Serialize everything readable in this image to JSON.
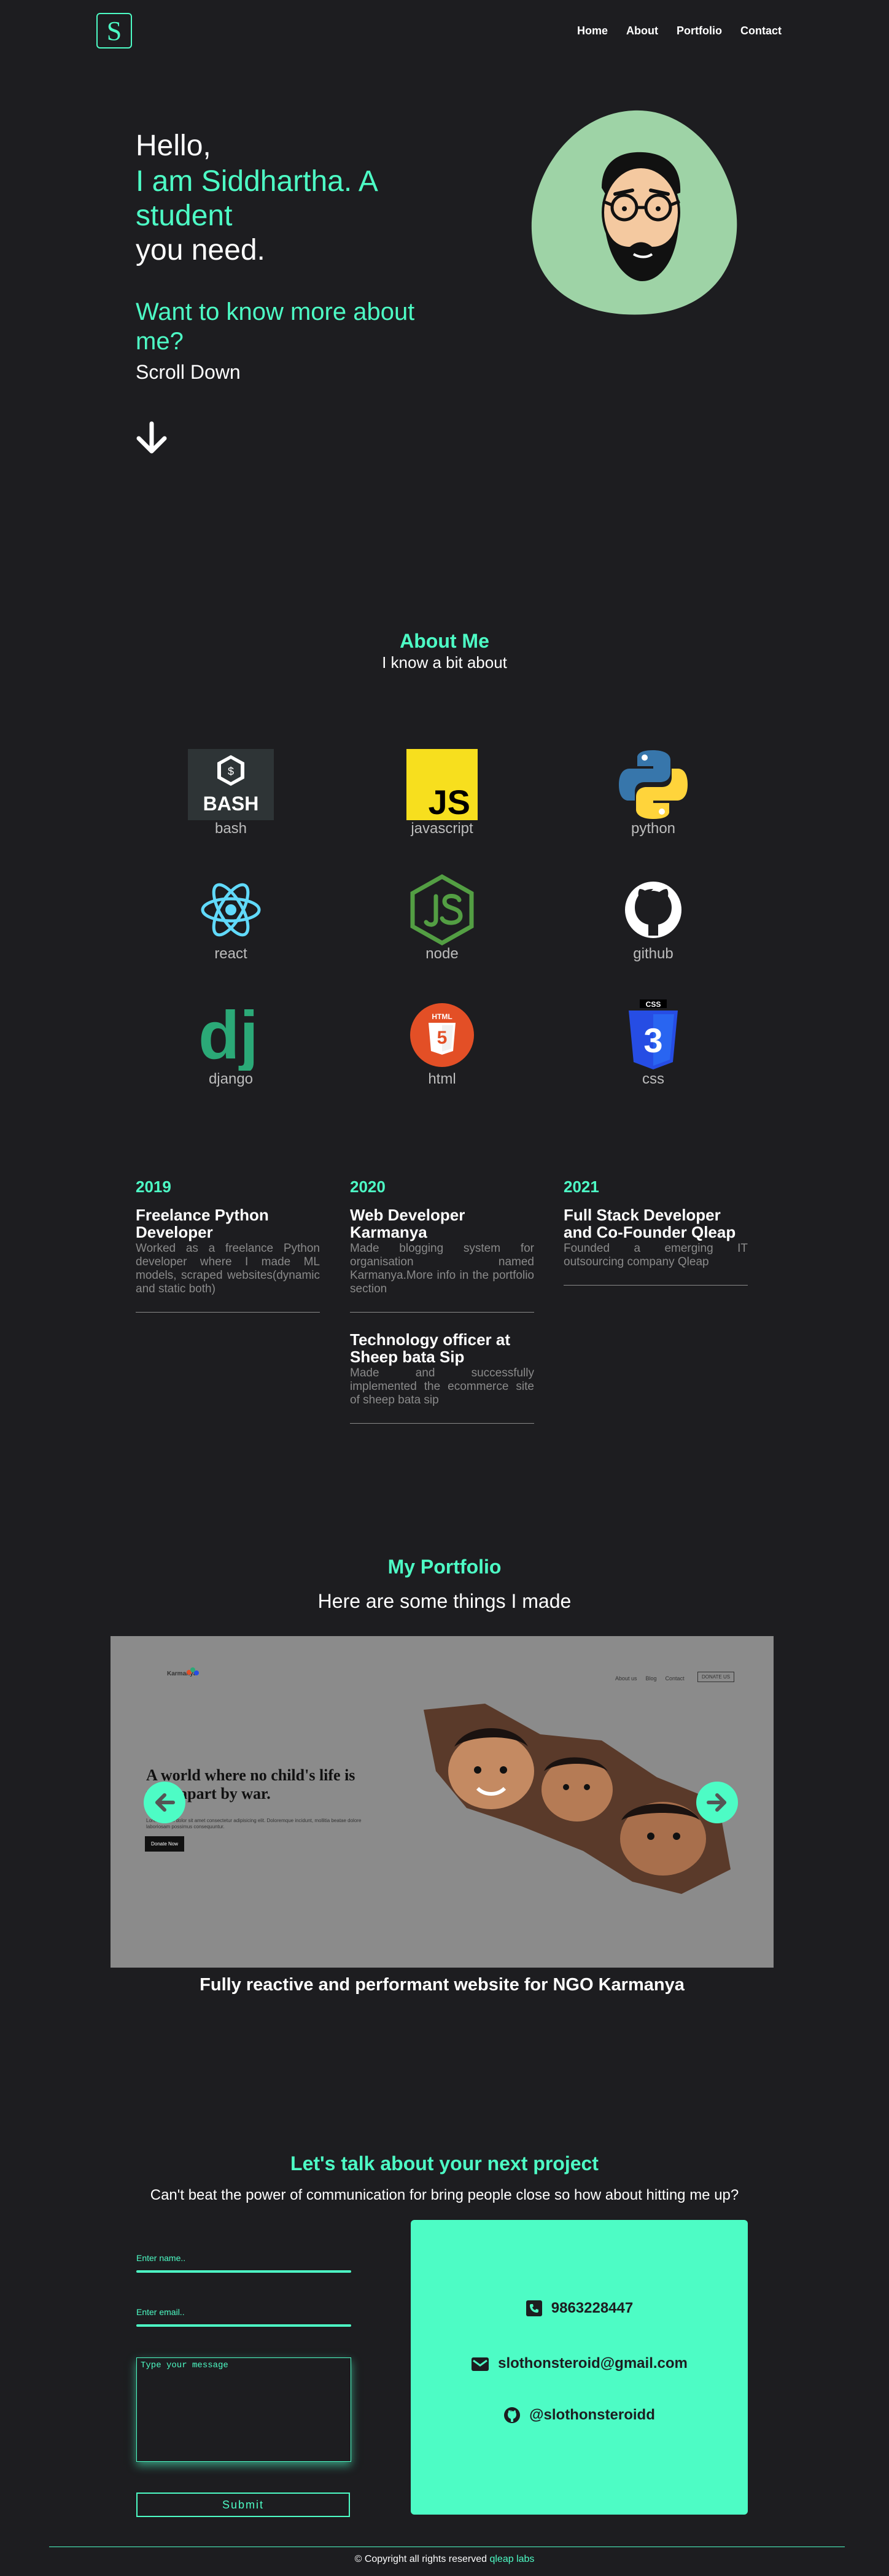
{
  "header": {
    "logo_letter": "S",
    "nav": [
      "Home",
      "About",
      "Portfolio",
      "Contact"
    ]
  },
  "hero": {
    "hello": "Hello,",
    "name_line": "I am Siddhartha. A student",
    "need": "you need.",
    "want": "Want to know more about me?",
    "scroll": "Scroll Down"
  },
  "about": {
    "title": "About Me",
    "subtitle": "I know a bit about",
    "skills": [
      {
        "label": "bash",
        "icon": "bash-icon"
      },
      {
        "label": "javascript",
        "icon": "javascript-icon"
      },
      {
        "label": "python",
        "icon": "python-icon"
      },
      {
        "label": "react",
        "icon": "react-icon"
      },
      {
        "label": "node",
        "icon": "node-icon"
      },
      {
        "label": "github",
        "icon": "github-icon"
      },
      {
        "label": "django",
        "icon": "django-icon"
      },
      {
        "label": "html",
        "icon": "html-icon"
      },
      {
        "label": "css",
        "icon": "css-icon"
      }
    ],
    "icon_text": {
      "bash": "BASH",
      "js": "JS",
      "dj": "dj",
      "html": "HTML",
      "css": "CSS"
    }
  },
  "timeline": [
    {
      "year": "2019",
      "entries": [
        {
          "role": "Freelance Python Developer",
          "desc": "Worked as a freelance Python developer where I made ML models, scraped websites(dynamic and static both)"
        }
      ]
    },
    {
      "year": "2020",
      "entries": [
        {
          "role": "Web Developer Karmanya",
          "desc": "Made blogging system for organisation named Karmanya.More info in the portfolio section"
        },
        {
          "role": "Technology officer at Sheep bata Sip",
          "desc": "Made and successfully implemented the ecommerce site of sheep bata sip"
        }
      ]
    },
    {
      "year": "2021",
      "entries": [
        {
          "role": "Full Stack Developer and Co-Founder Qleap",
          "desc": "Founded a emerging IT outsourcing company Qleap"
        }
      ]
    }
  ],
  "portfolio": {
    "title": "My Portfolio",
    "subtitle": "Here are some things I made",
    "caption": "Fully reactive and performant website for NGO Karmanya",
    "screenshot": {
      "brand": "Karmanya",
      "nav": [
        "About us",
        "Blog",
        "Contact"
      ],
      "cta": "DONATE US",
      "headline_1": "A world where no child's life is",
      "headline_2": "torn apart by war.",
      "body": "Lorem ipsum dolor sit amet consectetur adipisicing elit. Doloremque incidunt, mollitia beatae dolore laboriosam possimus consequuntur.",
      "button": "Donate Now"
    }
  },
  "contact": {
    "title": "Let's talk about your next project",
    "subtitle": "Can't beat the power of communication for bring people close so how about hitting me up?",
    "name_placeholder": "Enter name..",
    "email_placeholder": "Enter email..",
    "message_placeholder": "Type your message",
    "submit": "Submit",
    "phone": "9863228447",
    "email": "slothonsteroid@gmail.com",
    "github": "@slothonsteroidd"
  },
  "footer": {
    "text": "© Copyright all rights reserved",
    "brand": "qleap labs"
  },
  "colors": {
    "accent": "#4dfcc5",
    "background": "#1d1d20"
  }
}
